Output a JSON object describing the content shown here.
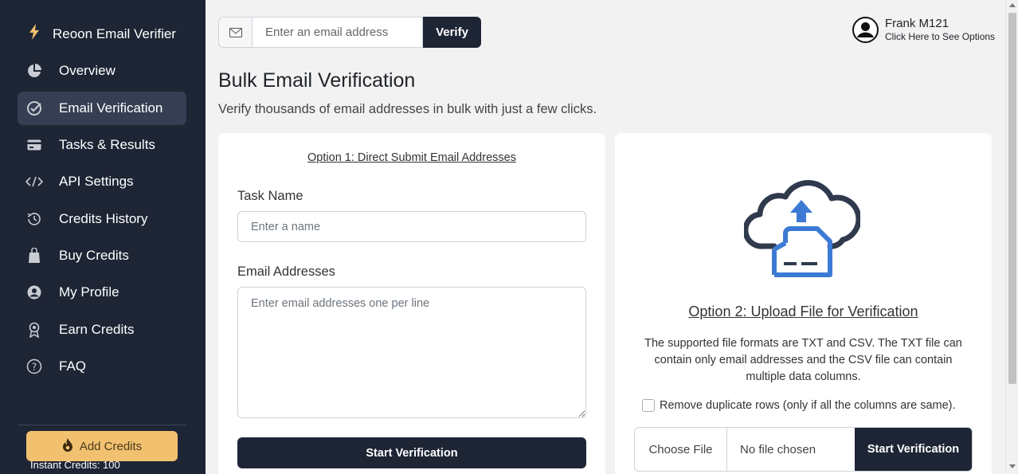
{
  "sidebar": {
    "brand": "Reoon Email Verifier",
    "items": [
      {
        "label": "Overview",
        "icon": "pie-chart-icon"
      },
      {
        "label": "Email Verification",
        "icon": "check-circle-icon",
        "active": true
      },
      {
        "label": "Tasks & Results",
        "icon": "credit-card-icon"
      },
      {
        "label": "API Settings",
        "icon": "code-icon"
      },
      {
        "label": "Credits History",
        "icon": "history-icon"
      },
      {
        "label": "Buy Credits",
        "icon": "shopping-bag-icon"
      },
      {
        "label": "My Profile",
        "icon": "user-circle-icon"
      },
      {
        "label": "Earn Credits",
        "icon": "award-icon"
      },
      {
        "label": "FAQ",
        "icon": "question-circle-icon"
      }
    ],
    "add_credits": "Add Credits",
    "instant_credits": "Instant Credits: 100"
  },
  "topbar": {
    "email_placeholder": "Enter an email address",
    "verify_label": "Verify"
  },
  "user": {
    "name": "Frank M121",
    "subtitle": "Click Here to See Options"
  },
  "page": {
    "title": "Bulk Email Verification",
    "subtitle": "Verify thousands of email addresses in bulk with just a few clicks."
  },
  "option1": {
    "heading": "Option 1: Direct Submit Email Addresses",
    "task_name_label": "Task Name",
    "task_name_placeholder": "Enter a name",
    "emails_label": "Email Addresses",
    "emails_placeholder": "Enter email addresses one per line",
    "start_label": "Start Verification"
  },
  "option2": {
    "heading": "Option 2: Upload File for Verification",
    "description": "The supported file formats are TXT and CSV. The TXT file can contain only email addresses and the CSV file can contain multiple data columns.",
    "dedupe_label": "Remove duplicate rows (only if all the columns are same).",
    "choose_file": "Choose File",
    "no_file": "No file chosen",
    "start_label": "Start Verification"
  },
  "colors": {
    "sidebar_bg": "#1e2535",
    "active_bg": "#353e52",
    "accent_button": "#f2c170",
    "cloud_icon_dark": "#2f3a4d",
    "cloud_icon_blue": "#3c7ad4"
  }
}
